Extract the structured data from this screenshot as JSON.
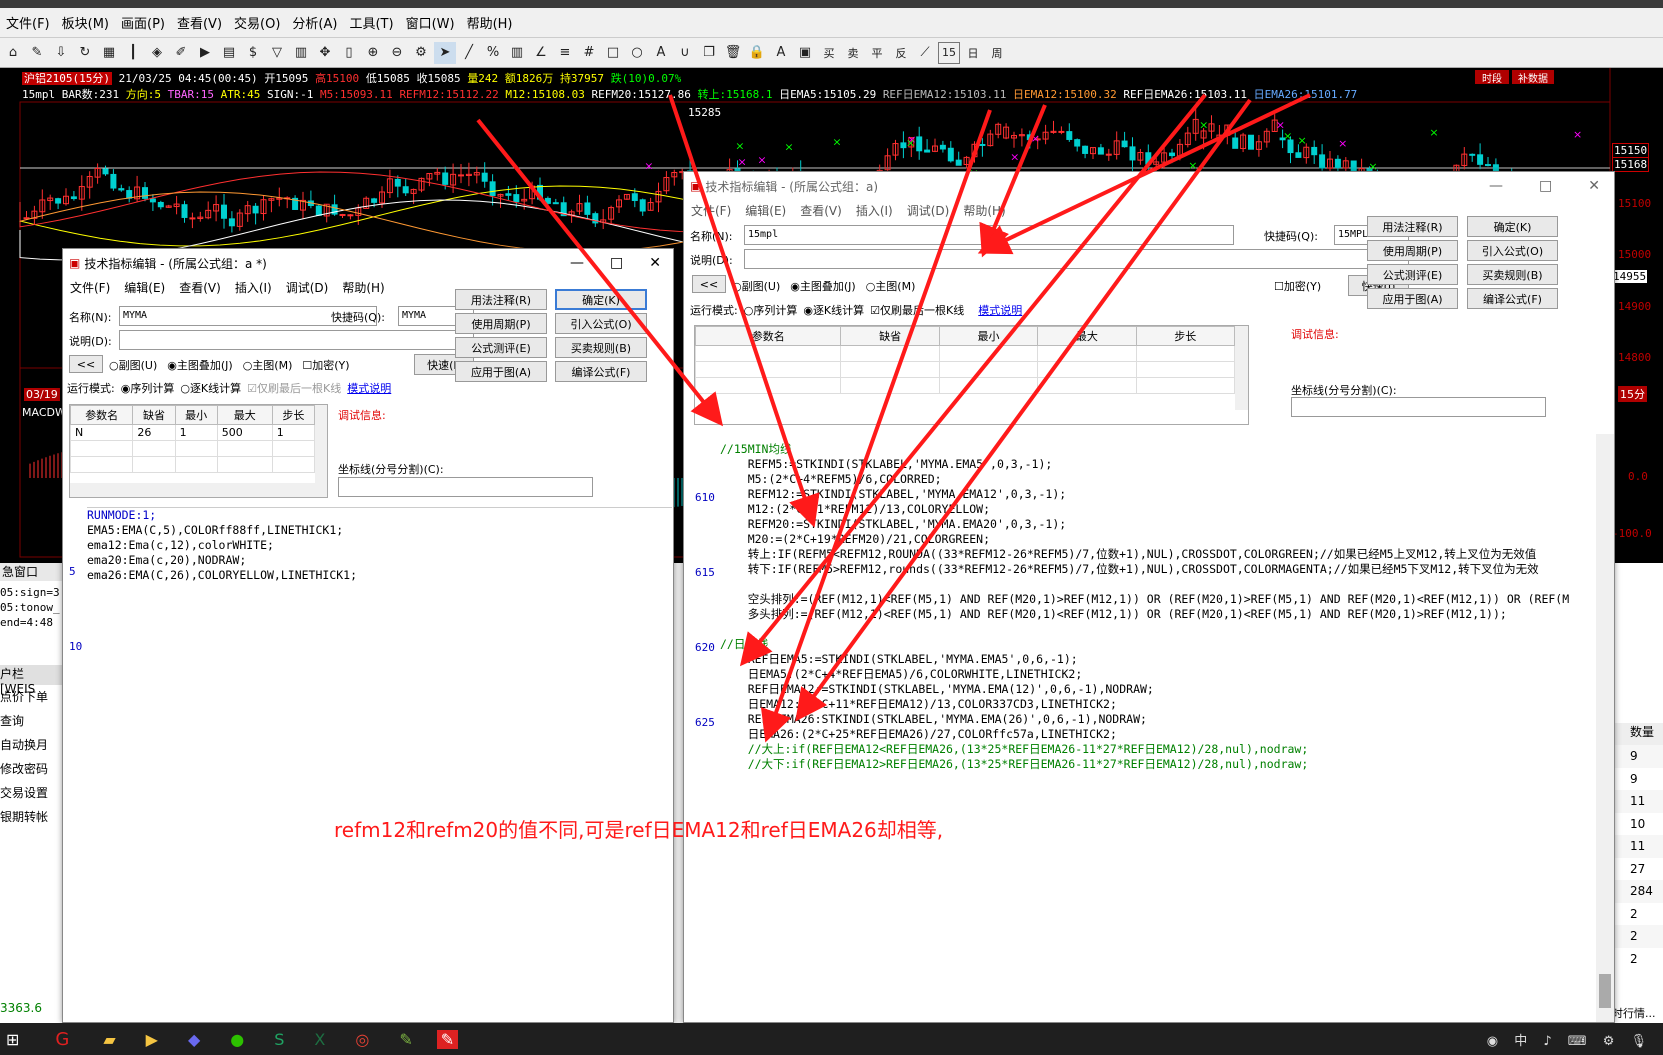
{
  "app_menu": [
    "文件(F)",
    "板块(M)",
    "画面(P)",
    "查看(V)",
    "交易(O)",
    "分析(A)",
    "工具(T)",
    "窗口(W)",
    "帮助(H)"
  ],
  "chart": {
    "ticker": "沪铝2105(15分)",
    "datetime": "21/03/25 04:45(00:45)",
    "open": "开15095",
    "high": "高15100",
    "low": "低15085",
    "close": "收15085",
    "volume": "量242",
    "amount": "额1826万",
    "hold": "持37957",
    "change": "跌(10)0.07%",
    "indicator_name": "15mpl",
    "bar_count": "BAR数:231",
    "bar_dir": "方向:5",
    "tbar": "TBAR:15",
    "atr": "ATR:45",
    "sign": "SIGN:-1",
    "m5": "M5:15093.11",
    "refm12": "REFM12:15112.22",
    "m12": "M12:15108.03",
    "refm20": "REFM20:15127.86",
    "turn_up": "转上:15168.1",
    "day_ema5": "日EMA5:15105.29",
    "ref_day_ema12": "REF日EMA12:15103.11",
    "day_ema12": "日EMA12:15100.32",
    "ref_day_ema26": "REF日EMA26:15103.11",
    "day_ema26": "日EMA26:15101.77",
    "price_marker": "15285",
    "time_btn": "时段",
    "supplement_btn": "补数据",
    "axis_labels": [
      "15100",
      "15000",
      "14955",
      "14900",
      "14800",
      "15分"
    ],
    "axis_labels_ext": [
      "15150",
      "15168"
    ],
    "macd_label": "MACDW",
    "macd_axis": [
      "0.0",
      "-100.0"
    ],
    "left_date": "03/19"
  },
  "left_panel": {
    "title": "急窗口",
    "lines": [
      "05:sign=3",
      "05:tonow_",
      "end=4:48"
    ],
    "account": "户栏 [WEIS",
    "items": [
      "点价下单",
      "查询",
      "自动换月",
      "修改密码",
      "交易设置",
      "银期转帐"
    ],
    "balance": "3363.6"
  },
  "right_panel": {
    "header": "数量",
    "values": [
      "9",
      "9",
      "11",
      "10",
      "11",
      "27",
      "284",
      "2",
      "2",
      "2"
    ],
    "footer": "时行情..."
  },
  "dlg1": {
    "title": "技术指标编辑 - (所属公式组：a *)",
    "menu": [
      "文件(F)",
      "编辑(E)",
      "查看(V)",
      "插入(I)",
      "调试(D)",
      "帮助(H)"
    ],
    "name_label": "名称(N):",
    "name_value": "MYMA",
    "shortcut_label": "快捷码(Q):",
    "shortcut_value": "MYMA",
    "desc_label": "说明(D):",
    "radio_sub": "副图(U)",
    "radio_main_overlay": "主图叠加(J)",
    "radio_main": "主图(M)",
    "check_encrypt": "加密(Y)",
    "btn_fast": "快速(I)",
    "run_mode_label": "运行模式:",
    "run_seq": "序列计算",
    "run_step": "逐K线计算",
    "last_only": "仅刷最后一根K线",
    "mode_help": "模式说明",
    "buttons": [
      "用法注释(R)",
      "确定(K)",
      "使用周期(P)",
      "引入公式(O)",
      "公式测评(E)",
      "买卖规则(B)",
      "应用于图(A)",
      "编译公式(F)"
    ],
    "param_headers": [
      "参数名",
      "缺省",
      "最小",
      "最大",
      "步长"
    ],
    "param_row": [
      "N",
      "26",
      "1",
      "500",
      "1"
    ],
    "debug_label": "调试信息:",
    "axis_label": "坐标线(分号分割)(C):",
    "line_numbers": [
      "5",
      "10"
    ],
    "code": [
      {
        "t": "RUNMODE:1;",
        "c": "#0000c8"
      },
      {
        "t": "EMA5:EMA(C,5),COLORff88ff,LINETHICK1;",
        "c": "#000"
      },
      {
        "t": "ema12:Ema(c,12),colorWHITE;",
        "c": "#000"
      },
      {
        "t": "ema20:Ema(c,20),NODRAW;",
        "c": "#000"
      },
      {
        "t": "ema26:EMA(C,26),COLORYELLOW,LINETHICK1;",
        "c": "#000"
      }
    ]
  },
  "dlg2": {
    "title": "技术指标编辑 - (所属公式组：a)",
    "menu": [
      "文件(F)",
      "编辑(E)",
      "查看(V)",
      "插入(I)",
      "调试(D)",
      "帮助(H)"
    ],
    "name_label": "名称(N):",
    "name_value": "15mpl",
    "shortcut_label": "快捷码(Q):",
    "shortcut_value": "15MPL",
    "desc_label": "说明(D):",
    "radio_sub": "副图(U)",
    "radio_main_overlay": "主图叠加(J)",
    "radio_main": "主图(M)",
    "check_encrypt": "加密(Y)",
    "btn_fast": "快速(I)",
    "run_mode_label": "运行模式:",
    "run_seq": "序列计算",
    "run_step": "逐K线计算",
    "last_only": "仅刷最后一根K线",
    "mode_help": "模式说明",
    "buttons": [
      "用法注释(R)",
      "确定(K)",
      "使用周期(P)",
      "引入公式(O)",
      "公式测评(E)",
      "买卖规则(B)",
      "应用于图(A)",
      "编译公式(F)"
    ],
    "param_headers": [
      "参数名",
      "缺省",
      "最小",
      "最大",
      "步长"
    ],
    "debug_label": "调试信息:",
    "axis_label": "坐标线(分号分割)(C):",
    "line_numbers": [
      "610",
      "615",
      "620",
      "625"
    ],
    "code": [
      {
        "t": "//15MIN均线",
        "c": "#008000"
      },
      {
        "t": "    REFM5:=STKINDI(STKLABEL,'MYMA.EMA5',0,3,-1);",
        "c": "#000"
      },
      {
        "t": "    M5:(2*C+4*REFM5)/6,COLORRED;",
        "c": "#000"
      },
      {
        "t": "    REFM12:=STKINDI(STKLABEL,'MYMA.EMA12',0,3,-1);",
        "c": "#000"
      },
      {
        "t": "    M12:(2*C+11*REFM12)/13,COLORYELLOW;",
        "c": "#000"
      },
      {
        "t": "    REFM20:=STKINDI(STKLABEL,'MYMA.EMA20',0,3,-1);",
        "c": "#000"
      },
      {
        "t": "    M20:=(2*C+19*REFM20)/21,COLORGREEN;",
        "c": "#000"
      },
      {
        "t": "    转上:IF(REFM5<REFM12,ROUNDA((33*REFM12-26*REFM5)/7,位数+1),NUL),CROSSDOT,COLORGREEN;//如果已经M5上叉M12,转上叉位为无效值",
        "c": "#000"
      },
      {
        "t": "    转下:IF(REFM5>REFM12,rounds((33*REFM12-26*REFM5)/7,位数+1),NUL),CROSSDOT,COLORMAGENTA;//如果已经M5下叉M12,转下叉位为无效",
        "c": "#000"
      },
      {
        "t": "",
        "c": "#000"
      },
      {
        "t": "    空头排列:=(REF(M12,1)<REF(M5,1) AND REF(M20,1)>REF(M12,1)) OR (REF(M20,1)>REF(M5,1) AND REF(M20,1)<REF(M12,1)) OR (REF(M",
        "c": "#000"
      },
      {
        "t": "    多头排列:=(REF(M12,1)<REF(M5,1) AND REF(M20,1)<REF(M12,1)) OR (REF(M20,1)<REF(M5,1) AND REF(M20,1)>REF(M12,1));",
        "c": "#000"
      },
      {
        "t": "",
        "c": "#000"
      },
      {
        "t": "//日均线",
        "c": "#008000"
      },
      {
        "t": "    REF日EMA5:=STKINDI(STKLABEL,'MYMA.EMA5',0,6,-1);",
        "c": "#000"
      },
      {
        "t": "    日EMA5:(2*C+4*REF日EMA5)/6,COLORWHITE,LINETHICK2;",
        "c": "#000"
      },
      {
        "t": "    REF日EMA12:=STKINDI(STKLABEL,'MYMA.EMA(12)',0,6,-1),NODRAW;",
        "c": "#000"
      },
      {
        "t": "    日EMA12:(2*C+11*REF日EMA12)/13,COLOR337CD3,LINETHICK2;",
        "c": "#000"
      },
      {
        "t": "    REF日EMA26:STKINDI(STKLABEL,'MYMA.EMA(26)',0,6,-1),NODRAW;",
        "c": "#000"
      },
      {
        "t": "    日EMA26:(2*C+25*REF日EMA26)/27,COLORffc57a,LINETHICK2;",
        "c": "#000"
      },
      {
        "t": "    //大上:if(REF日EMA12<REF日EMA26,(13*25*REF日EMA26-11*27*REF日EMA12)/28,nul),nodraw;",
        "c": "#008000"
      },
      {
        "t": "    //大下:if(REF日EMA12>REF日EMA26,(13*25*REF日EMA26-11*27*REF日EMA12)/28,nul),nodraw;",
        "c": "#008000"
      }
    ]
  },
  "annotation": "refm12和refm20的值不同,可是ref日EMA12和ref日EMA26却相等,",
  "colors": {
    "accent_red": "#ff1a1a",
    "bull": "#ff3030",
    "bear": "#00d0d0",
    "grid": "#5a0000"
  }
}
